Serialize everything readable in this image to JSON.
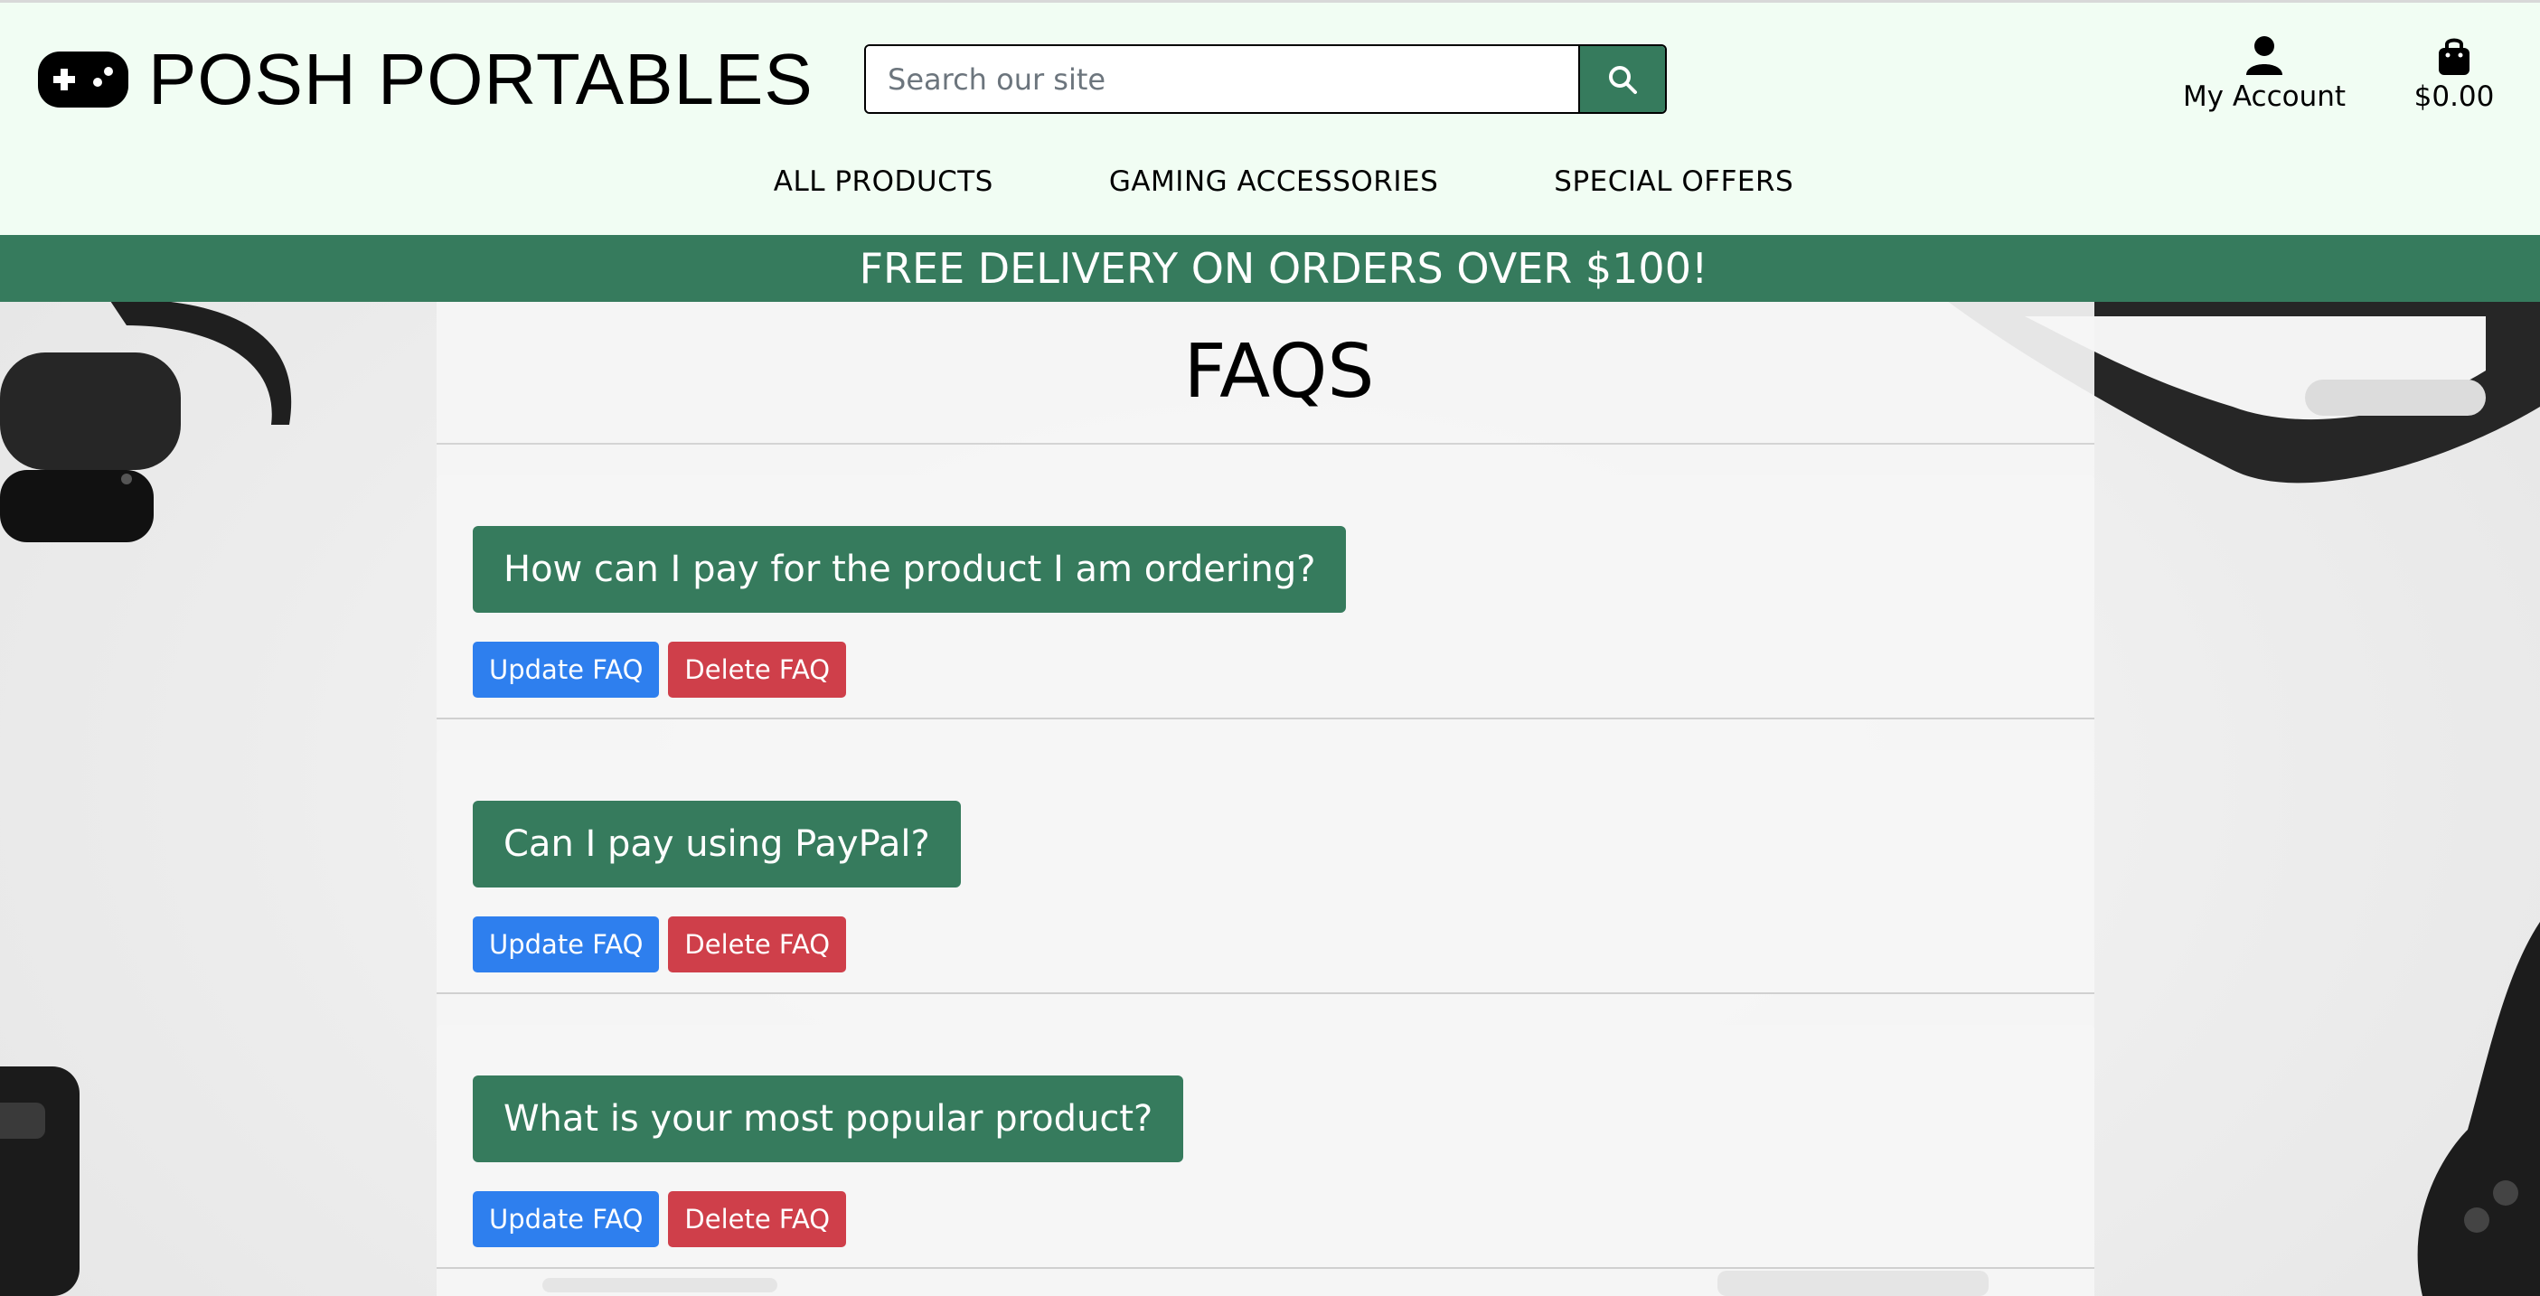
{
  "brand": {
    "name": "POSH PORTABLES",
    "logo_icon": "gamepad-icon"
  },
  "search": {
    "placeholder": "Search our site",
    "button_icon": "search-icon"
  },
  "account": {
    "label": "My Account",
    "icon": "user-icon"
  },
  "cart": {
    "total": "$0.00",
    "icon": "shopping-bag-icon"
  },
  "nav": {
    "items": [
      {
        "label": "ALL PRODUCTS"
      },
      {
        "label": "GAMING ACCESSORIES"
      },
      {
        "label": "SPECIAL OFFERS"
      }
    ]
  },
  "banner": {
    "text": "FREE DELIVERY ON ORDERS OVER $100!"
  },
  "page": {
    "title": "FAQS"
  },
  "faqs": [
    {
      "question": "How can I pay for the product I am ordering?",
      "update_label": "Update FAQ",
      "delete_label": "Delete FAQ"
    },
    {
      "question": "Can I pay using PayPal?",
      "update_label": "Update FAQ",
      "delete_label": "Delete FAQ"
    },
    {
      "question": "What is your most popular product?",
      "update_label": "Update FAQ",
      "delete_label": "Delete FAQ"
    }
  ],
  "colors": {
    "header_bg": "#f1fdf3",
    "brand_green": "#367b5d",
    "update_blue": "#2e7fee",
    "delete_red": "#cf3f4a"
  }
}
